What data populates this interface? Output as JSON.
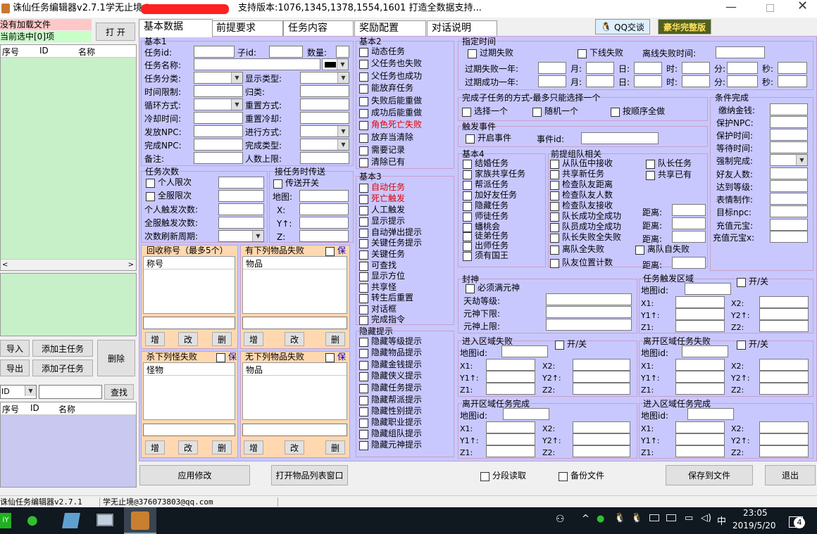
{
  "window": {
    "title": "诛仙任务编辑器v2.7.1",
    "user": "学无止境@",
    "support": "支持版本:1076,1345,1378,1554,1601 打造全数据支持..."
  },
  "left": {
    "status1": "没有加载文件",
    "status2": "当前选中[0]项",
    "open": "打 开",
    "cols": [
      "序号",
      "ID",
      "名称"
    ],
    "import": "导入",
    "export": "导出",
    "add_main": "添加主任务",
    "add_sub": "添加子任务",
    "delete": "删除",
    "search_field": "ID",
    "search": "查找",
    "cols2": [
      "序号",
      "ID",
      "名称"
    ]
  },
  "tabs": [
    "基本数据",
    "前提要求",
    "任务内容",
    "奖励配置",
    "对话说明"
  ],
  "top_right": {
    "qq": "QQ交谈",
    "deluxe": "豪华完整版"
  },
  "basic1": {
    "title": "基本1",
    "task_id": "任务id:",
    "sub_id": "子id:",
    "count": "数量:",
    "name": "任务名称:",
    "type": "任务分类:",
    "show_type": "显示类型:",
    "time_limit": "时间限制:",
    "belong": "归类:",
    "loop": "循环方式:",
    "reset_way": "重置方式:",
    "cooldown": "冷却时间:",
    "reset_cool": "重置冷却:",
    "issue_npc": "发放NPC:",
    "proceed": "进行方式:",
    "finish_npc": "完成NPC:",
    "finish_type": "完成类型:",
    "note": "备注:",
    "people_max": "人数上限:"
  },
  "counts": {
    "title": "任务次数",
    "personal": "个人限次",
    "all": "全服限次",
    "personal_trig": "个人触发次数:",
    "all_trig": "全服触发次数:",
    "refresh": "次数刷新周期:"
  },
  "transfer": {
    "title": "接任务时传送",
    "switch": "传送开关",
    "map": "地图:",
    "x": "X:",
    "y": "Y↑:",
    "z": "Z:"
  },
  "recycle": {
    "title": "回收称号（最多5个）",
    "col": "称号",
    "add": "增",
    "edit": "改",
    "del": "删"
  },
  "has_item_fail": {
    "title": "有下列物品失败",
    "keep": "保",
    "col": "物品",
    "add": "增",
    "edit": "改",
    "del": "删"
  },
  "kill_fail": {
    "title": "杀下列怪失败",
    "keep": "保",
    "col": "怪物",
    "add": "增",
    "edit": "改",
    "del": "删"
  },
  "no_item_fail": {
    "title": "无下列物品失败",
    "keep": "保",
    "col": "物品",
    "add": "增",
    "edit": "改",
    "del": "删"
  },
  "basic2": {
    "title": "基本2",
    "items": [
      "动态任务",
      "父任务也失败",
      "父任务也成功",
      "能放弃任务",
      "失败后能重做",
      "成功后能重做",
      "角色死亡失败",
      "放弃当清除",
      "需要记录",
      "清除已有"
    ]
  },
  "basic3": {
    "title": "基本3",
    "items": [
      "自动任务",
      "死亡触发",
      "人工触发",
      "显示提示",
      "自动弹出提示",
      "关键任务提示",
      "关键任务",
      "可查找",
      "显示方位",
      "共享怪",
      "转生后重置",
      "对话框",
      "完成指令"
    ]
  },
  "hide": {
    "title": "隐藏提示",
    "items": [
      "隐藏等级提示",
      "隐藏物品提示",
      "隐藏金钱提示",
      "隐藏侠义提示",
      "隐藏任务提示",
      "隐藏帮派提示",
      "隐藏性别提示",
      "隐藏职业提示",
      "隐藏组队提示",
      "隐藏元神提示"
    ]
  },
  "specified": {
    "title": "指定时间",
    "expire_fail": "过期失败",
    "offline_fail": "下线失败",
    "offline_time": "离线失败时间:",
    "fail_year": "过期失败一年:",
    "success_year": "过期成功一年:",
    "month": "月:",
    "day": "日:",
    "hour": "时:",
    "minute": "分:",
    "second": "秒:"
  },
  "subtask": {
    "title": "完成子任务的方式-最多只能选择一个",
    "choose_one": "选择一个",
    "random_one": "随机一个",
    "in_order": "按顺序全做"
  },
  "trigger": {
    "title": "触发事件",
    "open": "开启事件",
    "event_id": "事件id:"
  },
  "basic4": {
    "title": "基本4",
    "items": [
      "结婚任务",
      "家族共享任务",
      "帮派任务",
      "加好友任务",
      "隐藏任务",
      "师徒任务",
      "蟠桃会",
      "徒弟任务",
      "出师任务",
      "须有国王"
    ]
  },
  "team": {
    "title": "前提组队相关",
    "items": [
      "从队伍中接收",
      "共享新任务",
      "检查队友距离",
      "检查队友人数",
      "检查队友接收",
      "队长成功全成功",
      "队员成功全成功",
      "队长失败全失败",
      "离队全失败",
      "队友位置计数"
    ],
    "leader_task": "队长任务",
    "shared": "共享已有",
    "self_fail": "离队自失败",
    "distance": "距离:"
  },
  "cond": {
    "title": "条件完成",
    "items": [
      "缴纳金钱:",
      "保护NPC:",
      "保护时间:",
      "等待时间:",
      "强制完成:",
      "好友人数:",
      "达到等级:",
      "表情制作:",
      "目标npc:",
      "充值元宝:",
      "充值元宝x:"
    ]
  },
  "seal": {
    "title": "封神",
    "must": "必须满元神",
    "tianjie": "天劫等级:",
    "yuanshen_low": "元神下限:",
    "yuanshen_high": "元神上限:"
  },
  "trig_area": {
    "title": "任务触发区域",
    "switch": "开/关",
    "map": "地图id:",
    "x1": "X1:",
    "x2": "X2:",
    "y1": "Y1↑:",
    "y2": "Y2↑:",
    "z1": "Z1:",
    "z2": "Z2:"
  },
  "enter_fail": {
    "title": "进入区域失败",
    "switch": "开/关",
    "map": "地图id:",
    "x1": "X1:",
    "x2": "X2:",
    "y1": "Y1↑:",
    "y2": "Y2↑:",
    "z1": "Z1:",
    "z2": "Z2:"
  },
  "leave_fail": {
    "title": "离开区域任务失败",
    "switch": "开/关",
    "map": "地图id:",
    "x1": "X1:",
    "x2": "X2:",
    "y1": "Y1↑:",
    "y2": "Y2↑:",
    "z1": "Z1:",
    "z2": "Z2:"
  },
  "leave_done": {
    "title": "离开区域任务完成",
    "map": "地图id:",
    "x1": "X1:",
    "x2": "X2:",
    "y1": "Y1↑:",
    "y2": "Y2↑:",
    "z1": "Z1:",
    "z2": "Z2:"
  },
  "enter_done": {
    "title": "进入区域任务完成",
    "map": "地图id:",
    "x1": "X1:",
    "x2": "X2:",
    "y1": "Y1↑:",
    "y2": "Y2↑:",
    "z1": "Z1:",
    "z2": "Z2:"
  },
  "bottom": {
    "apply": "应用修改",
    "open_items": "打开物品列表窗口",
    "segment": "分段读取",
    "backup": "备份文件",
    "save": "保存到文件",
    "exit": "退出"
  },
  "status": {
    "app": "诛仙任务编辑器v2.7.1",
    "author": "学无止境@376073803@qq.com"
  },
  "taskbar": {
    "time": "23:05",
    "date": "2019/5/20",
    "ime": "中",
    "badge": "4"
  },
  "colors": {
    "panel": "#c8c8ff",
    "peach": "#ffd8b0",
    "green": "#c8f0c8",
    "red": "#ff2020"
  }
}
